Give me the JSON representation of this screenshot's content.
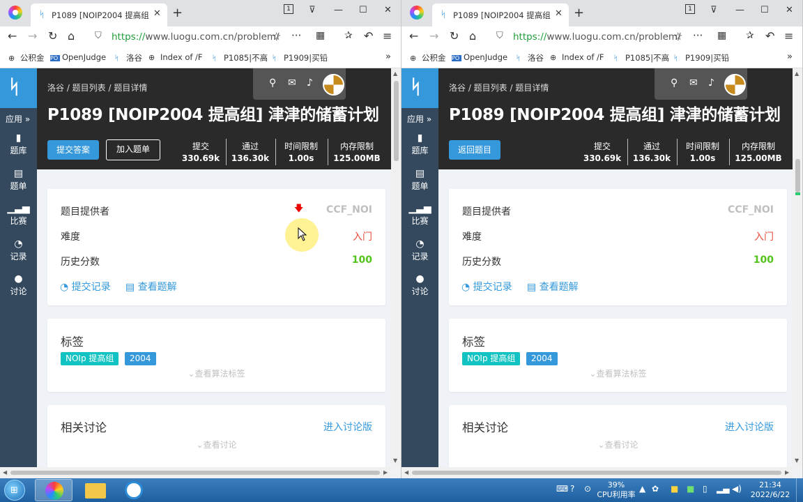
{
  "browser": {
    "tab_title": "P1089 [NOIP2004 提高组] 津",
    "tab_count": "1",
    "url_scheme": "https://",
    "url_rest": "www.luogu.com.cn/problem/",
    "bookmarks": [
      "公积金",
      "OpenJudge",
      "洛谷",
      "Index of /F",
      "P1085|不高",
      "P1909|买铅"
    ]
  },
  "site": {
    "app_label": "应用",
    "nav": [
      "题库",
      "题单",
      "比赛",
      "记录",
      "讨论"
    ],
    "breadcrumb": "洛谷 / 题目列表 / 题目详情",
    "problem_title": "P1089 [NOIP2004 提高组] 津津的储蓄计划",
    "left_submit_button": "提交答案",
    "left_add_button": "加入题单",
    "right_back_button": "返回题目",
    "stats": [
      {
        "name": "提交",
        "value": "330.69k"
      },
      {
        "name": "通过",
        "value": "136.30k"
      },
      {
        "name": "时间限制",
        "value": "1.00s"
      },
      {
        "name": "内存限制",
        "value": "125.00MB"
      }
    ],
    "info": {
      "provider_label": "题目提供者",
      "provider_value": "CCF_NOI",
      "difficulty_label": "难度",
      "difficulty_value": "入门",
      "history_label": "历史分数",
      "history_value": "100",
      "records_link": "提交记录",
      "solutions_link": "查看题解"
    },
    "tags": {
      "title": "标签",
      "items": [
        "NOIp 提高组",
        "2004"
      ],
      "fold_text": "查看算法标签"
    },
    "discuss": {
      "title": "相关讨论",
      "enter_link": "进入讨论版",
      "fold_text": "查看讨论"
    }
  },
  "taskbar": {
    "cpu_percent": "39%",
    "cpu_label": "CPU利用率",
    "time": "21:34",
    "date": "2022/6/22"
  },
  "colors": {
    "accent_blue": "#3498db",
    "sidebar": "#34495e",
    "header": "#2a2a2a",
    "difficulty_red": "#e74c3c",
    "score_green": "#52c41a",
    "tag_teal": "#13c2c2"
  }
}
